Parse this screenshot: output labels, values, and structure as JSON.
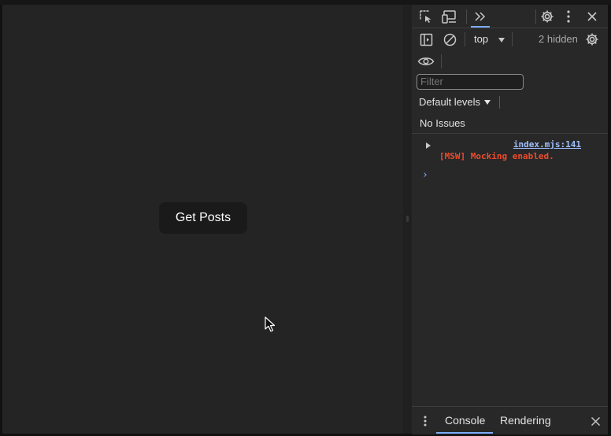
{
  "viewport": {
    "get_posts_label": "Get Posts"
  },
  "devtools": {
    "toolbar": {
      "inspect_icon": "inspect-element-icon",
      "device_icon": "device-toggle-icon",
      "more_tabs_icon": "chevron-double-right-icon",
      "settings_icon": "gear-icon",
      "menu_icon": "kebab-menu-icon",
      "close_icon": "close-icon"
    },
    "console_toolbar": {
      "context": "top",
      "hidden_count": "2 hidden"
    },
    "filter_placeholder": "Filter",
    "default_levels": "Default levels",
    "issues": "No Issues",
    "log": {
      "source": "index.mjs:141",
      "message": "[MSW] Mocking enabled."
    },
    "prompt": "›",
    "drawer": {
      "tab_console": "Console",
      "tab_rendering": "Rendering"
    }
  },
  "colors": {
    "accent": "#7cacf8",
    "error": "#ee4b2b",
    "page_bg": "#242424",
    "devtools_bg": "#282828"
  }
}
